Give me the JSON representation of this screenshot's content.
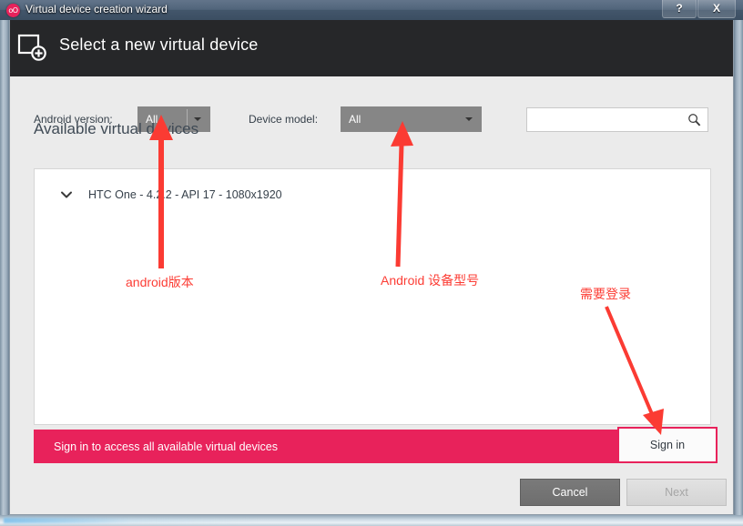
{
  "window": {
    "title": "Virtual device creation wizard",
    "app_icon": "genymotion-logo-icon",
    "help_label": "?",
    "close_label": "X"
  },
  "header": {
    "title": "Select a new virtual device",
    "icon": "add-device-icon"
  },
  "filters": {
    "android_version_label": "Android version:",
    "android_version_value": "All",
    "device_model_label": "Device model:",
    "device_model_value": "All",
    "search_value": "",
    "search_placeholder": "",
    "search_icon": "search-icon"
  },
  "main": {
    "section_title": "Available virtual devices",
    "devices": [
      {
        "label": "HTC One - 4.2.2 - API 17 - 1080x1920",
        "expand_icon": "chevron-down-icon"
      }
    ]
  },
  "signin": {
    "message": "Sign in to access all available virtual devices",
    "button_label": "Sign in"
  },
  "footer": {
    "cancel_label": "Cancel",
    "next_label": "Next"
  },
  "annotations": [
    {
      "text": "android版本"
    },
    {
      "text": "Android 设备型号"
    },
    {
      "text": "需要登录"
    }
  ],
  "colors": {
    "accent_pink": "#e8225b",
    "annotation_red": "#fc3d35",
    "header_dark": "#262729",
    "combo_gray": "#868686"
  }
}
